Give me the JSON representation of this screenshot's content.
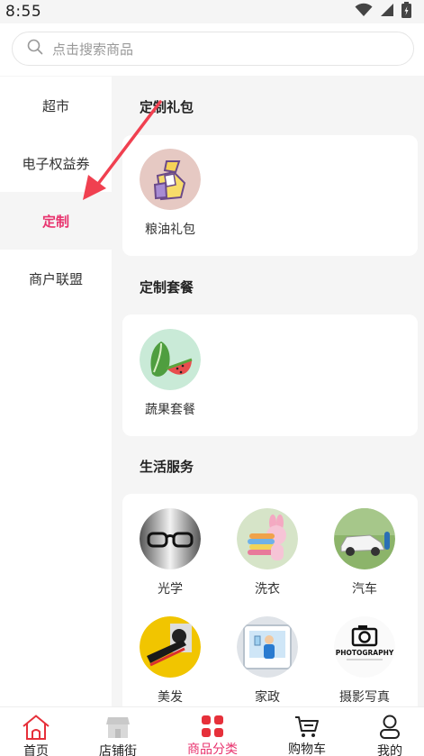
{
  "status": {
    "time": "8:55",
    "icons": [
      "wifi-icon",
      "signal-icon",
      "battery-icon"
    ]
  },
  "search": {
    "placeholder": "点击搜索商品"
  },
  "sidebar": {
    "items": [
      {
        "label": "超市",
        "active": false
      },
      {
        "label": "电子权益券",
        "active": false
      },
      {
        "label": "定制",
        "active": true
      },
      {
        "label": "商户联盟",
        "active": false
      }
    ]
  },
  "sections": [
    {
      "title": "定制礼包",
      "items": [
        {
          "label": "粮油礼包",
          "icon": "grain-oil-gift-bag-icon"
        }
      ]
    },
    {
      "title": "定制套餐",
      "items": [
        {
          "label": "蔬果套餐",
          "icon": "vegetable-fruit-icon"
        }
      ]
    },
    {
      "title": "生活服务",
      "items": [
        {
          "label": "光学",
          "icon": "glasses-icon"
        },
        {
          "label": "洗衣",
          "icon": "laundry-icon"
        },
        {
          "label": "汽车",
          "icon": "car-icon"
        },
        {
          "label": "美发",
          "icon": "hairdressing-icon"
        },
        {
          "label": "家政",
          "icon": "housekeeping-icon"
        },
        {
          "label": "摄影写真",
          "icon": "photography-icon",
          "image_text": "PHOTOGRAPHY"
        }
      ]
    }
  ],
  "bottom_nav": [
    {
      "label": "首页",
      "icon": "home-icon",
      "active": false
    },
    {
      "label": "店铺街",
      "icon": "store-icon",
      "active": false
    },
    {
      "label": "商品分类",
      "icon": "category-grid-icon",
      "active": true
    },
    {
      "label": "购物车",
      "icon": "cart-icon",
      "active": false
    },
    {
      "label": "我的",
      "icon": "user-icon",
      "active": false
    }
  ],
  "colors": {
    "accent": "#e8336e",
    "background": "#f5f5f5",
    "annotation_arrow": "#f04050"
  }
}
